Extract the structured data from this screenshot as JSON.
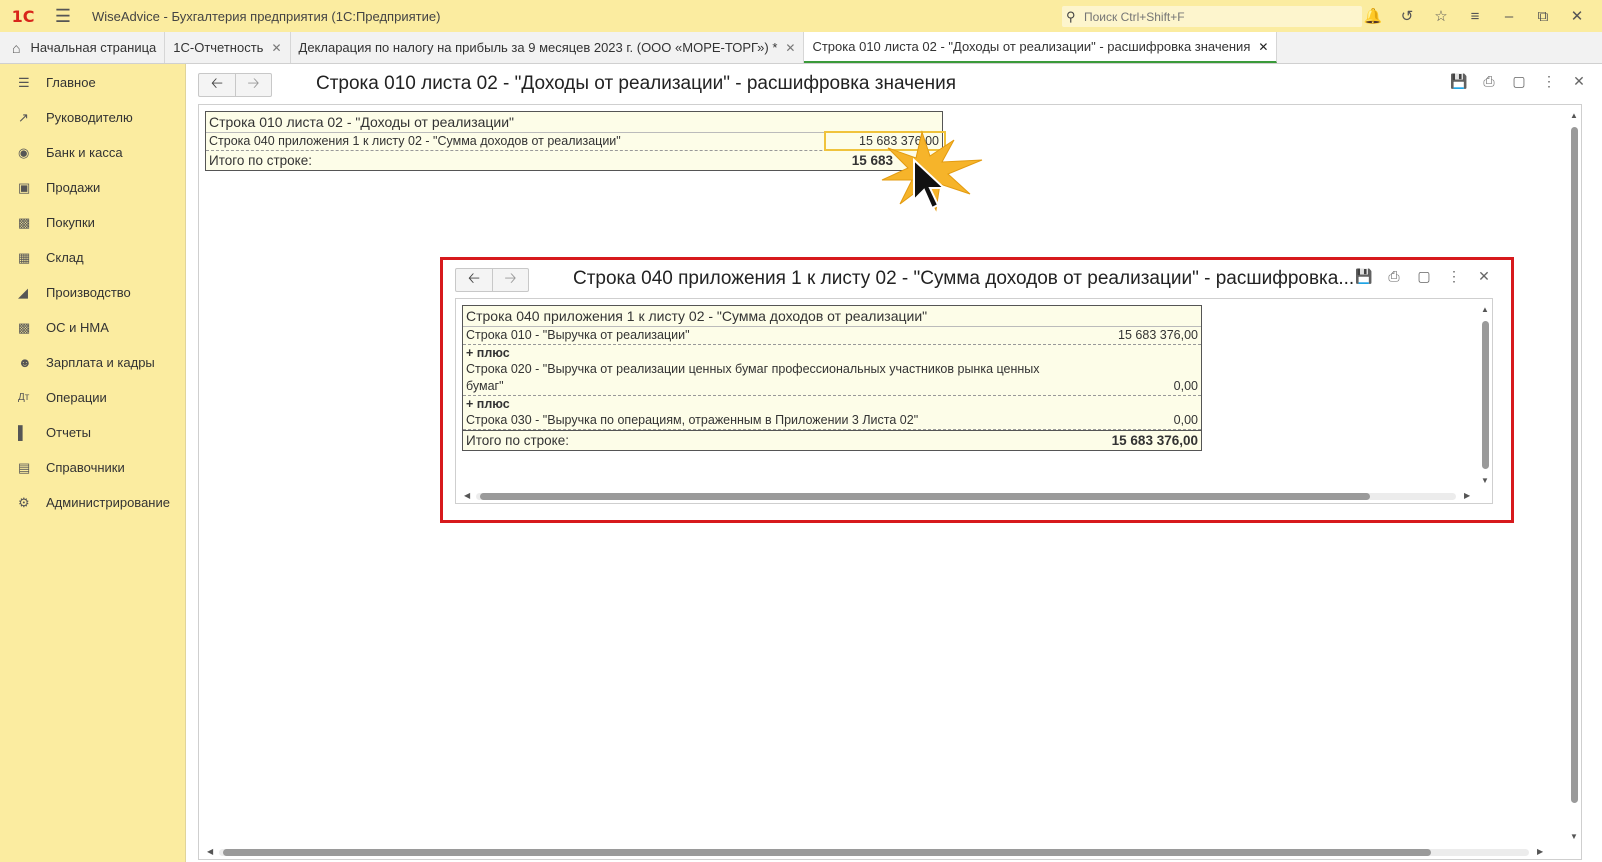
{
  "titlebar": {
    "logo": "1C",
    "title": "WiseAdvice - Бухгалтерия предприятия  (1С:Предприятие)",
    "search_placeholder": "Поиск Ctrl+Shift+F"
  },
  "tabs": [
    {
      "label": "Начальная страница"
    },
    {
      "label": "1С-Отчетность"
    },
    {
      "label": "Декларация по налогу на прибыль за 9 месяцев 2023 г. (ООО «МОРЕ-ТОРГ») *"
    },
    {
      "label": "Строка 010 листа 02 - \"Доходы от реализации\" - расшифровка значения"
    }
  ],
  "sidebar": {
    "items": [
      {
        "label": "Главное",
        "icon": "menu-lines-icon"
      },
      {
        "label": "Руководителю",
        "icon": "trend-icon"
      },
      {
        "label": "Банк и касса",
        "icon": "coin-icon"
      },
      {
        "label": "Продажи",
        "icon": "bag-icon"
      },
      {
        "label": "Покупки",
        "icon": "cart-icon"
      },
      {
        "label": "Склад",
        "icon": "grid-icon"
      },
      {
        "label": "Производство",
        "icon": "factory-icon"
      },
      {
        "label": "ОС и НМА",
        "icon": "truck-icon"
      },
      {
        "label": "Зарплата и кадры",
        "icon": "person-icon"
      },
      {
        "label": "Операции",
        "icon": "dt-kt-icon"
      },
      {
        "label": "Отчеты",
        "icon": "bar-chart-icon"
      },
      {
        "label": "Справочники",
        "icon": "books-icon"
      },
      {
        "label": "Администрирование",
        "icon": "gear-icon"
      }
    ]
  },
  "main": {
    "title": "Строка 010 листа 02 - \"Доходы от реализации\" - расшифровка значения",
    "report": {
      "header": "Строка 010 листа 02 - \"Доходы от реализации\"",
      "rows": [
        {
          "label": "Строка 040 приложения 1 к листу 02 - \"Сумма доходов от реализации\"",
          "value": "15 683 376,00"
        }
      ],
      "total_label": "Итого по строке:",
      "total_value": "15 683"
    }
  },
  "popup": {
    "title": "Строка 040 приложения 1 к листу 02 - \"Сумма доходов от реализации\" - расшифровка...",
    "report": {
      "header": "Строка 040 приложения 1 к листу 02 - \"Сумма доходов от реализации\"",
      "row1_label": "Строка 010 - \"Выручка от реализации\"",
      "row1_value": "15 683 376,00",
      "plus1": "+ плюс",
      "row2_label_a": "Строка 020 - \"Выручка от реализации ценных бумаг профессиональных участников рынка ценных",
      "row2_label_b": "бумаг\"",
      "row2_value": "0,00",
      "plus2": "+ плюс",
      "row3_label": "Строка 030 - \"Выручка по операциям, отраженным в Приложении 3 Листа 02\"",
      "row3_value": "0,00",
      "total_label": "Итого по строке:",
      "total_value": "15 683 376,00"
    }
  },
  "colors": {
    "sidebar_bg": "#fbeca0",
    "highlight_border": "#d7191c",
    "selection": "#f0c33c",
    "active_tab_underline": "#3a9a3a"
  }
}
